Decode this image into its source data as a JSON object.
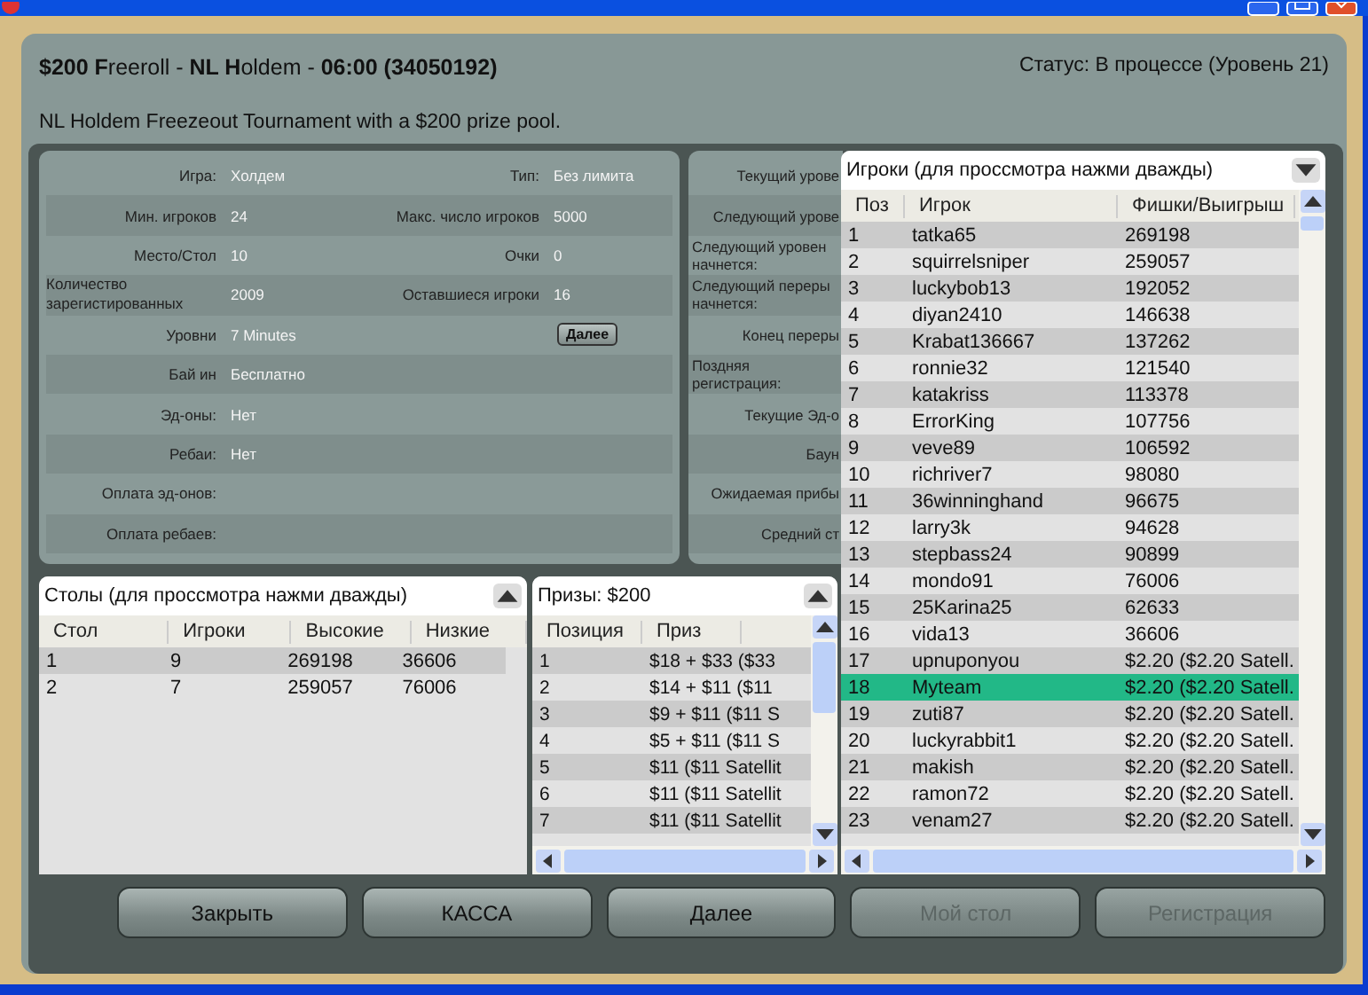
{
  "header": {
    "title": "**$200 F**reeroll - **NL H**oldem - **06:00 (34050192)**",
    "status": "Статус: В процессе (Уровень 21)",
    "description": "NL Holdem Freezeout Tournament with a $200 prize pool."
  },
  "info": {
    "rows": [
      {
        "label": "Игра:",
        "value": "Холдем",
        "label_2": "Тип:",
        "value_2": "Без лимита"
      },
      {
        "label": "Мин. игроков",
        "value": "24",
        "label_2": "Макс. число игроков",
        "value_2": "5000"
      },
      {
        "label": "Место/Стол",
        "value": "10",
        "label_2": "Очки",
        "value_2": "0"
      },
      {
        "label": "Количество зарегистированных",
        "value": "2009",
        "label_2": "Оставшиеся игроки",
        "value_2": "16"
      },
      {
        "label": "Уровни",
        "value": "7 Minutes",
        "button": "Далее"
      },
      {
        "label": "Бай ин",
        "value": "Бесплатно"
      },
      {
        "label": "Эд-оны:",
        "value": "Нет"
      },
      {
        "label": "Ребаи:",
        "value": "Нет"
      },
      {
        "label": "Оплата эд-онов:"
      },
      {
        "label": "Оплата ребаев:"
      }
    ]
  },
  "level_info": {
    "labels": [
      "Текущий урове",
      "Следующий урове",
      "Следующий уровен начнется:",
      "Следующий переры начнется:",
      "Конец переры",
      "Поздняя регистрация:",
      "Текущие Эд-о",
      "Баун",
      "Ожидаемая прибы",
      "Средний ст"
    ]
  },
  "tables": {
    "title": "Столы (для проссмотра нажми дважды)",
    "columns": [
      "Стол",
      "Игроки",
      "Высокие",
      "Низкие"
    ],
    "rows": [
      [
        "1",
        "9",
        "269198",
        "36606"
      ],
      [
        "2",
        "7",
        "259057",
        "76006"
      ]
    ]
  },
  "prizes": {
    "title": "Призы: $200",
    "columns": [
      "Позиция",
      "Приз"
    ],
    "rows": [
      [
        "1",
        "$18 + $33 ($33"
      ],
      [
        "2",
        "$14 + $11 ($11"
      ],
      [
        "3",
        "$9 + $11 ($11 S"
      ],
      [
        "4",
        "$5 + $11 ($11 S"
      ],
      [
        "5",
        "$11 ($11 Satellit"
      ],
      [
        "6",
        "$11 ($11 Satellit"
      ],
      [
        "7",
        "$11 ($11 Satellit"
      ]
    ]
  },
  "players": {
    "title": "Игроки (для проссмотра нажми дважды)",
    "columns": [
      "Поз",
      "Игрок",
      "Фишки/Выигрыш"
    ],
    "rows": [
      {
        "cells": [
          "1",
          "tatka65",
          "269198"
        ],
        "selected": false
      },
      {
        "cells": [
          "2",
          "squirrelsniper",
          "259057"
        ],
        "selected": false
      },
      {
        "cells": [
          "3",
          "luckybob13",
          "192052"
        ],
        "selected": false
      },
      {
        "cells": [
          "4",
          "diyan2410",
          "146638"
        ],
        "selected": false
      },
      {
        "cells": [
          "5",
          "Krabat136667",
          "137262"
        ],
        "selected": false
      },
      {
        "cells": [
          "6",
          "ronnie32",
          "121540"
        ],
        "selected": false
      },
      {
        "cells": [
          "7",
          "katakriss",
          "113378"
        ],
        "selected": false
      },
      {
        "cells": [
          "8",
          "ErrorKing",
          "107756"
        ],
        "selected": false
      },
      {
        "cells": [
          "9",
          "veve89",
          "106592"
        ],
        "selected": false
      },
      {
        "cells": [
          "10",
          "richriver7",
          "98080"
        ],
        "selected": false
      },
      {
        "cells": [
          "11",
          "36winninghand",
          "96675"
        ],
        "selected": false
      },
      {
        "cells": [
          "12",
          "larry3k",
          "94628"
        ],
        "selected": false
      },
      {
        "cells": [
          "13",
          "stepbass24",
          "90899"
        ],
        "selected": false
      },
      {
        "cells": [
          "14",
          "mondo91",
          "76006"
        ],
        "selected": false
      },
      {
        "cells": [
          "15",
          "25Karina25",
          "62633"
        ],
        "selected": false
      },
      {
        "cells": [
          "16",
          "vida13",
          "36606"
        ],
        "selected": false
      },
      {
        "cells": [
          "17",
          "upnuponyou",
          "$2.20 ($2.20 Satell."
        ],
        "selected": false
      },
      {
        "cells": [
          "18",
          "Myteam",
          "$2.20 ($2.20 Satell."
        ],
        "selected": true
      },
      {
        "cells": [
          "19",
          "zuti87",
          "$2.20 ($2.20 Satell."
        ],
        "selected": false
      },
      {
        "cells": [
          "20",
          "luckyrabbit1",
          "$2.20 ($2.20 Satell."
        ],
        "selected": false
      },
      {
        "cells": [
          "21",
          "makish",
          "$2.20 ($2.20 Satell."
        ],
        "selected": false
      },
      {
        "cells": [
          "22",
          "ramon72",
          "$2.20 ($2.20 Satell."
        ],
        "selected": false
      },
      {
        "cells": [
          "23",
          "venam27",
          "$2.20 ($2.20 Satell."
        ],
        "selected": false
      }
    ]
  },
  "buttons": [
    {
      "label": "Закрыть",
      "disabled": false
    },
    {
      "label": "КАССА",
      "disabled": false
    },
    {
      "label": "Далее",
      "disabled": false
    },
    {
      "label": "Мой стол",
      "disabled": true
    },
    {
      "label": "Регистрация",
      "disabled": true
    }
  ]
}
